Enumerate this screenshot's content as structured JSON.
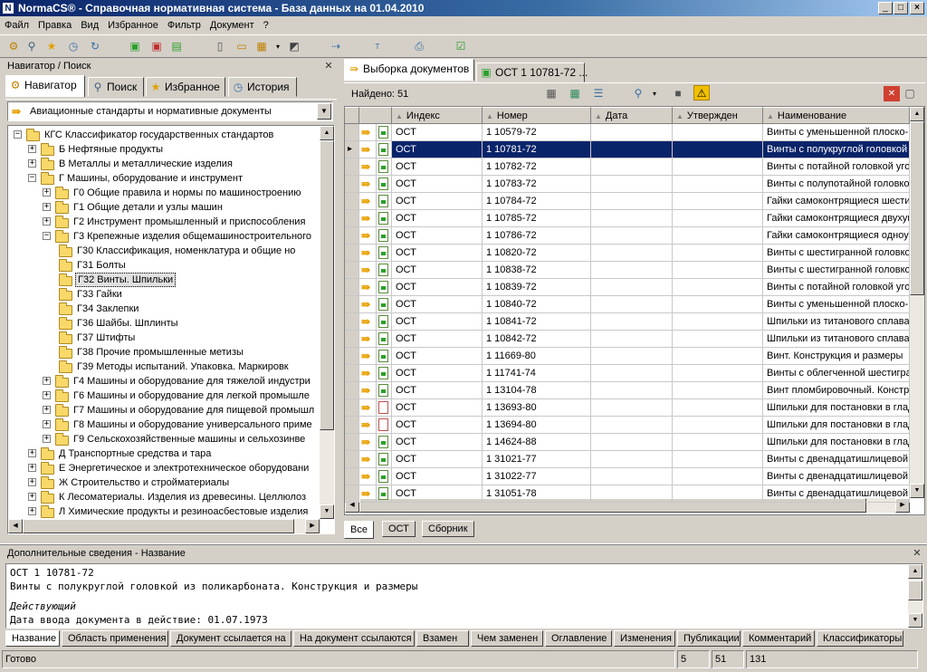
{
  "window": {
    "title": "NormaCS® - Справочная нормативная система - База данных на 01.04.2010",
    "app_icon": "N"
  },
  "menu": [
    "Файл",
    "Правка",
    "Вид",
    "Избранное",
    "Фильтр",
    "Документ",
    "?"
  ],
  "navigator": {
    "header": "Навигатор / Поиск",
    "tabs": [
      "Навигатор",
      "Поиск",
      "Избранное",
      "История"
    ],
    "combo_value": "Авиационные стандарты и нормативные документы",
    "tree": [
      {
        "label": "КГС  Классификатор государственных стандартов",
        "level": 0,
        "toggle": "−"
      },
      {
        "label": "Б  Нефтяные продукты",
        "level": 1,
        "toggle": "+"
      },
      {
        "label": "В  Металлы и металлические изделия",
        "level": 1,
        "toggle": "+"
      },
      {
        "label": "Г  Машины, оборудование и инструмент",
        "level": 1,
        "toggle": "−"
      },
      {
        "label": "Г0  Общие правила и нормы по машиностроению",
        "level": 2,
        "toggle": "+"
      },
      {
        "label": "Г1  Общие детали и узлы машин",
        "level": 2,
        "toggle": "+"
      },
      {
        "label": "Г2  Инструмент промышленный и приспособления",
        "level": 2,
        "toggle": "+"
      },
      {
        "label": "Г3  Крепежные изделия общемашиностроительного",
        "level": 2,
        "toggle": "−"
      },
      {
        "label": "Г30  Классификация, номенклатура и общие но",
        "level": 3,
        "toggle": ""
      },
      {
        "label": "Г31  Болты",
        "level": 3,
        "toggle": ""
      },
      {
        "label": "Г32  Винты. Шпильки",
        "level": 3,
        "toggle": "",
        "selected": true
      },
      {
        "label": "Г33  Гайки",
        "level": 3,
        "toggle": ""
      },
      {
        "label": "Г34  Заклепки",
        "level": 3,
        "toggle": ""
      },
      {
        "label": "Г36  Шайбы. Шплинты",
        "level": 3,
        "toggle": ""
      },
      {
        "label": "Г37  Штифты",
        "level": 3,
        "toggle": ""
      },
      {
        "label": "Г38  Прочие промышленные метизы",
        "level": 3,
        "toggle": ""
      },
      {
        "label": "Г39  Методы испытаний. Упаковка. Маркировк",
        "level": 3,
        "toggle": ""
      },
      {
        "label": "Г4  Машины и оборудование для тяжелой индустри",
        "level": 2,
        "toggle": "+"
      },
      {
        "label": "Г6  Машины и оборудование для легкой промышле",
        "level": 2,
        "toggle": "+"
      },
      {
        "label": "Г7  Машины и оборудование для пищевой промышл",
        "level": 2,
        "toggle": "+"
      },
      {
        "label": "Г8  Машины и оборудование универсального приме",
        "level": 2,
        "toggle": "+"
      },
      {
        "label": "Г9  Сельскохозяйственные машины и сельхозинве",
        "level": 2,
        "toggle": "+"
      },
      {
        "label": "Д  Транспортные средства и тара",
        "level": 1,
        "toggle": "+"
      },
      {
        "label": "Е  Энергетическое и электротехническое оборудовани",
        "level": 1,
        "toggle": "+"
      },
      {
        "label": "Ж  Строительство и стройматериалы",
        "level": 1,
        "toggle": "+"
      },
      {
        "label": "К  Лесоматериалы. Изделия из древесины. Целлюлоз",
        "level": 1,
        "toggle": "+"
      },
      {
        "label": "Л  Химические продукты и резиноасбестовые изделия",
        "level": 1,
        "toggle": "+"
      }
    ]
  },
  "docs": {
    "tabs": [
      "Выборка документов",
      "ОСТ 1 10781-72 ..."
    ],
    "found_label": "Найдено: 51",
    "columns": [
      "Индекс",
      "Номер",
      "Дата",
      "Утвержден",
      "Наименование"
    ],
    "rows": [
      {
        "index": "ОСТ",
        "number": "1 10579-72",
        "name": "Винты с уменьшенной плоско-в",
        "doc": "green"
      },
      {
        "index": "ОСТ",
        "number": "1 10781-72",
        "name": "Винты с полукруглой головкой",
        "doc": "green",
        "selected": true
      },
      {
        "index": "ОСТ",
        "number": "1 10782-72",
        "name": "Винты с потайной головкой уго",
        "doc": "green"
      },
      {
        "index": "ОСТ",
        "number": "1 10783-72",
        "name": "Винты с полупотайной головкой",
        "doc": "green"
      },
      {
        "index": "ОСТ",
        "number": "1 10784-72",
        "name": "Гайки самоконтрящиеся шести",
        "doc": "green"
      },
      {
        "index": "ОСТ",
        "number": "1 10785-72",
        "name": "Гайки самоконтрящиеся двухуш",
        "doc": "green"
      },
      {
        "index": "ОСТ",
        "number": "1 10786-72",
        "name": "Гайки самоконтрящиеся одноу",
        "doc": "green"
      },
      {
        "index": "ОСТ",
        "number": "1 10820-72",
        "name": "Винты с шестигранной головко",
        "doc": "green"
      },
      {
        "index": "ОСТ",
        "number": "1 10838-72",
        "name": "Винты с шестигранной головко",
        "doc": "green"
      },
      {
        "index": "ОСТ",
        "number": "1 10839-72",
        "name": "Винты с потайной головкой уго",
        "doc": "green"
      },
      {
        "index": "ОСТ",
        "number": "1 10840-72",
        "name": "Винты с уменьшенной плоско-в",
        "doc": "green"
      },
      {
        "index": "ОСТ",
        "number": "1 10841-72",
        "name": "Шпильки из титанового сплава",
        "doc": "green"
      },
      {
        "index": "ОСТ",
        "number": "1 10842-72",
        "name": "Шпильки из титанового сплава",
        "doc": "green"
      },
      {
        "index": "ОСТ",
        "number": "1 11669-80",
        "name": "Винт. Конструкция и размеры",
        "doc": "green"
      },
      {
        "index": "ОСТ",
        "number": "1 11741-74",
        "name": "Винты с облегченной шестигра",
        "doc": "green"
      },
      {
        "index": "ОСТ",
        "number": "1 13104-78",
        "name": "Винт пломбировочный. Констру",
        "doc": "green"
      },
      {
        "index": "ОСТ",
        "number": "1 13693-80",
        "name": "Шпильки для постановки в глад",
        "doc": "red"
      },
      {
        "index": "ОСТ",
        "number": "1 13694-80",
        "name": "Шпильки для постановки в глад",
        "doc": "red"
      },
      {
        "index": "ОСТ",
        "number": "1 14624-88",
        "name": "Шпильки для постановки в глад",
        "doc": "green"
      },
      {
        "index": "ОСТ",
        "number": "1 31021-77",
        "name": "Винты с двенадцатишлицевой г",
        "doc": "green"
      },
      {
        "index": "ОСТ",
        "number": "1 31022-77",
        "name": "Винты с двенадцатишлицевой г",
        "doc": "green"
      },
      {
        "index": "ОСТ",
        "number": "1 31051-78",
        "name": "Винты с двенадцатишлицевой г",
        "doc": "green"
      }
    ],
    "bottom_tabs": [
      "Все",
      "ОСТ",
      "Сборник"
    ]
  },
  "details": {
    "header": "Дополнительные сведения - Название",
    "line1": "ОСТ 1 10781-72",
    "line2": "Винты с полукруглой головкой из поликарбоната. Конструкция и размеры",
    "status": "Действующий",
    "date_line": "Дата ввода документа в действие: 01.07.1973",
    "tabs": [
      "Название",
      "Область применения",
      "Документ ссылается на",
      "На документ ссылаются",
      "Взамен",
      "Чем заменен",
      "Оглавление",
      "Изменения",
      "Публикации",
      "Комментарий",
      "Классификаторы"
    ]
  },
  "statusbar": {
    "text": "Готово",
    "v1": "5",
    "v2": "51",
    "v3": "131"
  },
  "icons": [
    "app-icon",
    "minimize-icon",
    "maximize-icon",
    "close-icon",
    "navigator-icon",
    "search-icon",
    "star-icon",
    "history-icon",
    "document-icon",
    "warning-icon",
    "folder-icon",
    "arrow-icon"
  ],
  "colors": {
    "selection": "#0a246a",
    "titlebar": "#0a246a",
    "folder": "#f8d868",
    "doc_green": "#2aa02a",
    "warning": "#f0c000"
  }
}
